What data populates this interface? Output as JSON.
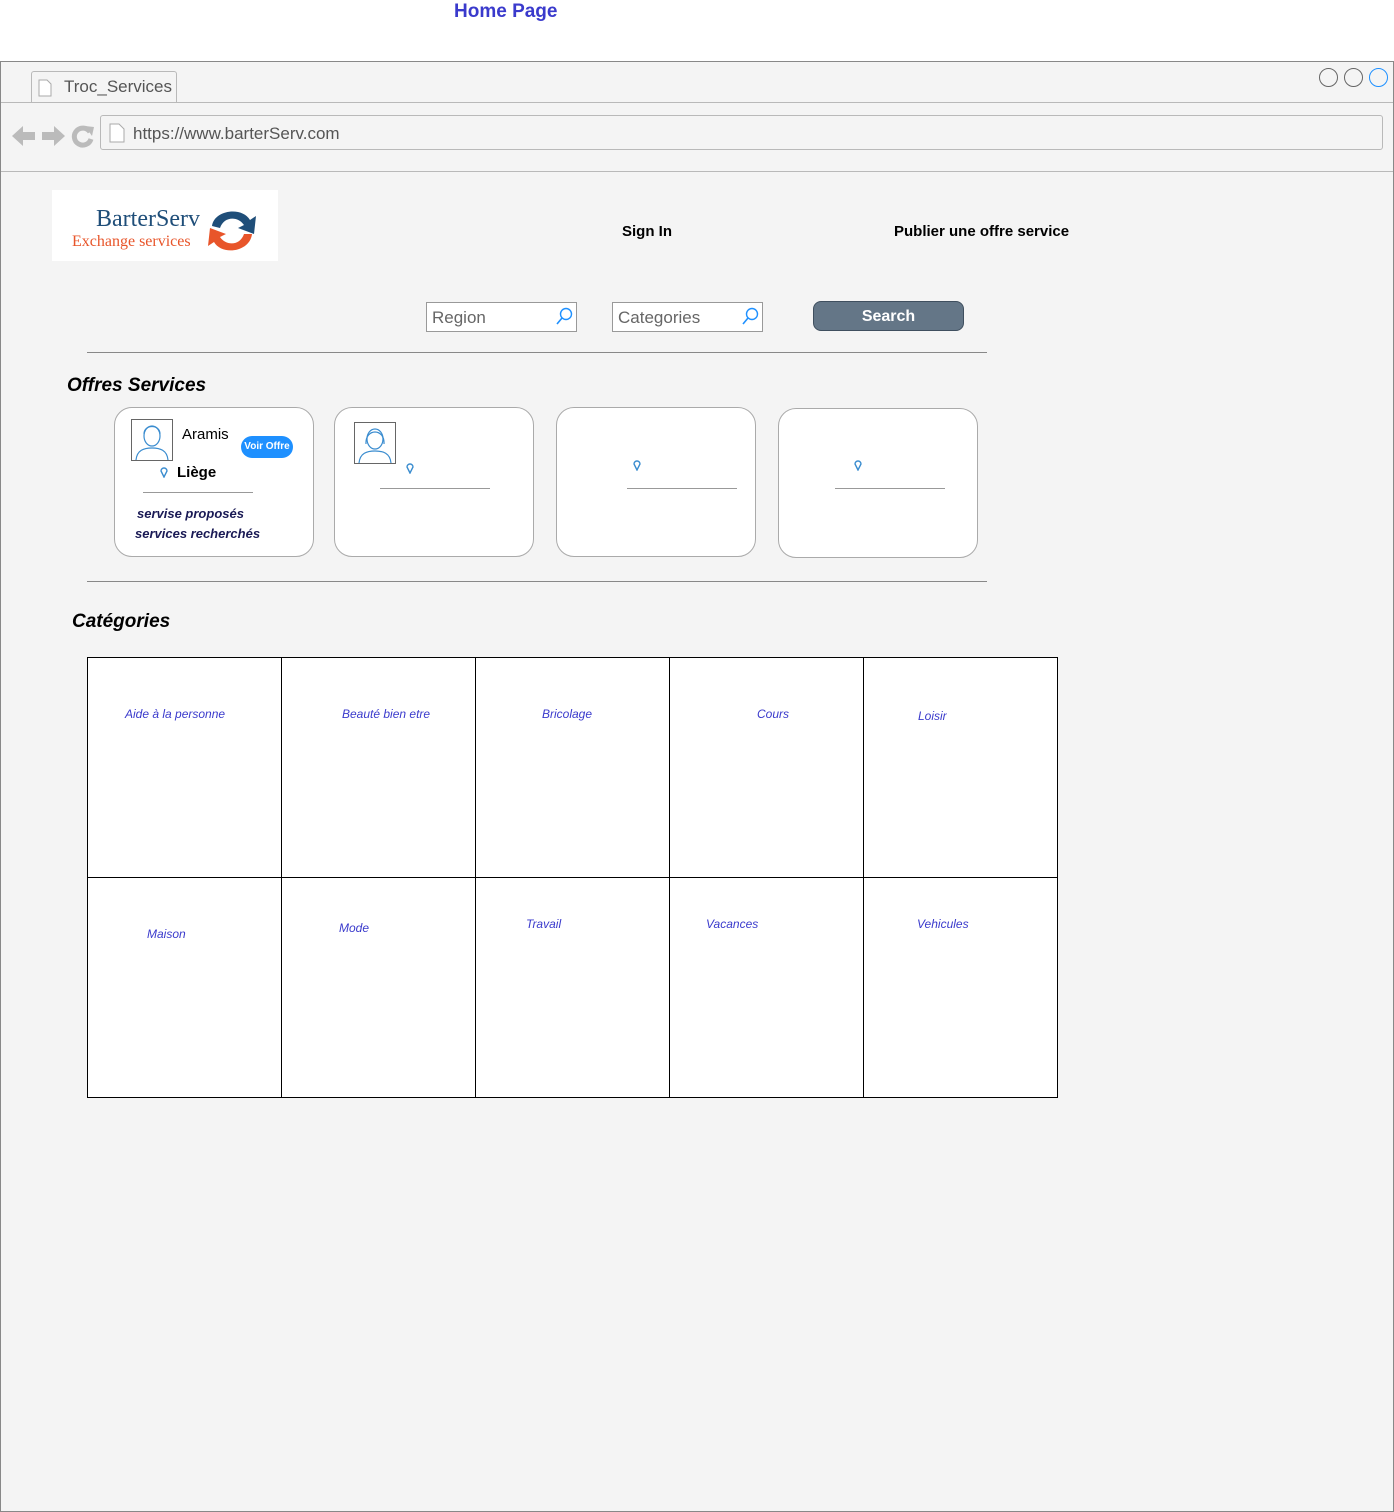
{
  "page_heading": "Home Page",
  "browser": {
    "tab_title": "Troc_Services",
    "url": "https://www.barterServ.com"
  },
  "header": {
    "logo_title": "BarterServ",
    "logo_subtitle": "Exchange services",
    "sign_in": "Sign In",
    "publish": "Publier une offre service"
  },
  "search": {
    "region_placeholder": "Region",
    "categories_placeholder": "Categories",
    "button": "Search"
  },
  "offers": {
    "title": "Offres Services",
    "cards": [
      {
        "name": "Aramis",
        "location": "Liège",
        "action": "Voir Offre",
        "services_offered": "servise proposés",
        "services_wanted": "services recherchés"
      }
    ]
  },
  "categories": {
    "title": "Catégories",
    "items": [
      "Aide à la personne",
      "Beauté bien etre",
      "Bricolage",
      "Cours",
      "Loisir",
      "Maison",
      "Mode",
      "Travail",
      "Vacances",
      "Vehicules"
    ]
  },
  "colors": {
    "accent_blue": "#3a3acc",
    "button_slate": "#647687",
    "voir_offre_blue": "#1e90ff",
    "logo_orange": "#e8552a",
    "logo_navy": "#1f4e79"
  }
}
